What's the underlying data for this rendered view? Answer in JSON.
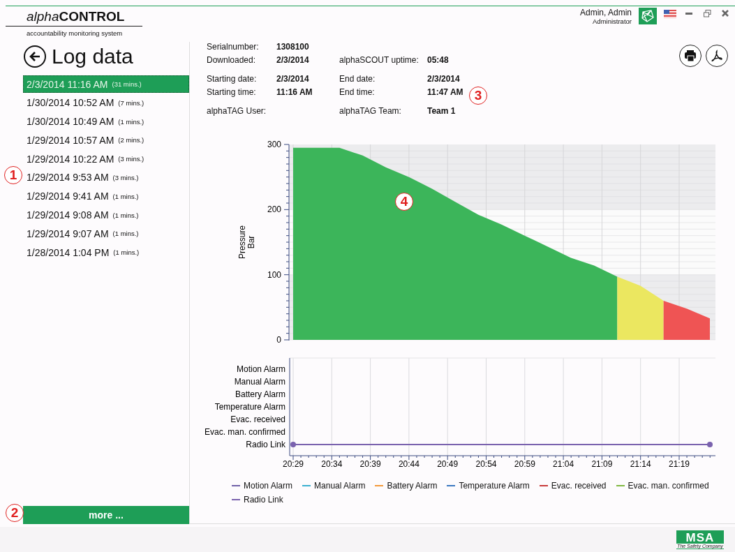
{
  "header": {
    "brand_prefix": "alpha",
    "brand": "CONTROL",
    "subtitle": "accountability monitoring system",
    "user_name": "Admin, Admin",
    "user_role": "Administrator"
  },
  "page_title": "Log data",
  "logs": [
    {
      "date": "2/3/2014 11:16 AM",
      "duration": "(31 mins.)",
      "selected": true
    },
    {
      "date": "1/30/2014 10:52 AM",
      "duration": "(7 mins.)",
      "selected": false
    },
    {
      "date": "1/30/2014 10:49 AM",
      "duration": "(1 mins.)",
      "selected": false
    },
    {
      "date": "1/29/2014 10:57 AM",
      "duration": "(2 mins.)",
      "selected": false
    },
    {
      "date": "1/29/2014 10:22 AM",
      "duration": "(3 mins.)",
      "selected": false
    },
    {
      "date": "1/29/2014 9:53 AM",
      "duration": "(3 mins.)",
      "selected": false
    },
    {
      "date": "1/29/2014 9:41 AM",
      "duration": "(1 mins.)",
      "selected": false
    },
    {
      "date": "1/29/2014 9:08 AM",
      "duration": "(1 mins.)",
      "selected": false
    },
    {
      "date": "1/29/2014 9:07 AM",
      "duration": "(1 mins.)",
      "selected": false
    },
    {
      "date": "1/28/2014 1:04 PM",
      "duration": "(1 mins.)",
      "selected": false
    }
  ],
  "more_button": "more ...",
  "info_groups": [
    {
      "rows": [
        {
          "left": {
            "label": "Serialnumber:",
            "value": "1308100"
          }
        },
        {
          "left": {
            "label": "Downloaded:",
            "value": "2/3/2014"
          },
          "right": {
            "label": "alphaSCOUT uptime:",
            "value": "05:48"
          }
        }
      ]
    },
    {
      "rows": [
        {
          "left": {
            "label": "Starting date:",
            "value": "2/3/2014"
          },
          "right": {
            "label": "End date:",
            "value": "2/3/2014"
          }
        },
        {
          "left": {
            "label": "Starting time:",
            "value": "11:16 AM"
          },
          "right": {
            "label": "End time:",
            "value": "11:47 AM"
          }
        }
      ]
    },
    {
      "rows": [
        {
          "left": {
            "label": "alphaTAG User:"
          },
          "right": {
            "label": "alphaTAG Team:",
            "value": "Team 1"
          }
        }
      ]
    }
  ],
  "pressure_chart": {
    "chart_data": {
      "type": "area",
      "ylabel": "Pressure Bar",
      "grid": true,
      "ylim": [
        0,
        300
      ],
      "yticks": [
        0,
        100,
        200,
        300
      ],
      "series": [
        {
          "color": "#3cb55a",
          "values": [
            295,
            295,
            295,
            283,
            265,
            250,
            232,
            212,
            192,
            177,
            160,
            143,
            126,
            114,
            97,
            null,
            null,
            null,
            null
          ]
        },
        {
          "color": "#ebe760",
          "values": [
            null,
            null,
            null,
            null,
            null,
            null,
            null,
            null,
            null,
            null,
            null,
            null,
            null,
            null,
            97,
            83,
            60,
            null,
            null
          ]
        },
        {
          "color": "#ef5454",
          "values": [
            null,
            null,
            null,
            null,
            null,
            null,
            null,
            null,
            null,
            null,
            null,
            null,
            null,
            null,
            null,
            null,
            60,
            48,
            33
          ]
        }
      ]
    }
  },
  "events_chart": {
    "lanes": [
      {
        "label": "Motion Alarm",
        "active": false
      },
      {
        "label": "Manual Alarm",
        "active": false
      },
      {
        "label": "Battery Alarm",
        "active": false
      },
      {
        "label": "Temperature Alarm",
        "active": false
      },
      {
        "label": "Evac. received",
        "active": false
      },
      {
        "label": "Evac. man. confirmed",
        "active": false
      },
      {
        "label": "Radio Link",
        "active": true
      }
    ],
    "time_labels": [
      "20:29",
      "20:34",
      "20:39",
      "20:44",
      "20:49",
      "20:54",
      "20:59",
      "21:04",
      "21:09",
      "21:14",
      "21:19"
    ],
    "legend": [
      {
        "label": "Motion Alarm",
        "color": "#7060a8"
      },
      {
        "label": "Manual Alarm",
        "color": "#3ab0d0"
      },
      {
        "label": "Battery Alarm",
        "color": "#f49a3a"
      },
      {
        "label": "Temperature Alarm",
        "color": "#3a78c0"
      },
      {
        "label": "Evac. received",
        "color": "#c83a3a"
      },
      {
        "label": "Evac. man. confirmed",
        "color": "#80b840"
      },
      {
        "label": "Radio Link",
        "color": "#7a62ae"
      }
    ]
  },
  "callouts": [
    "1",
    "2",
    "3",
    "4"
  ],
  "footer": {
    "logo": "MSA",
    "tagline": "The Safety Company"
  }
}
